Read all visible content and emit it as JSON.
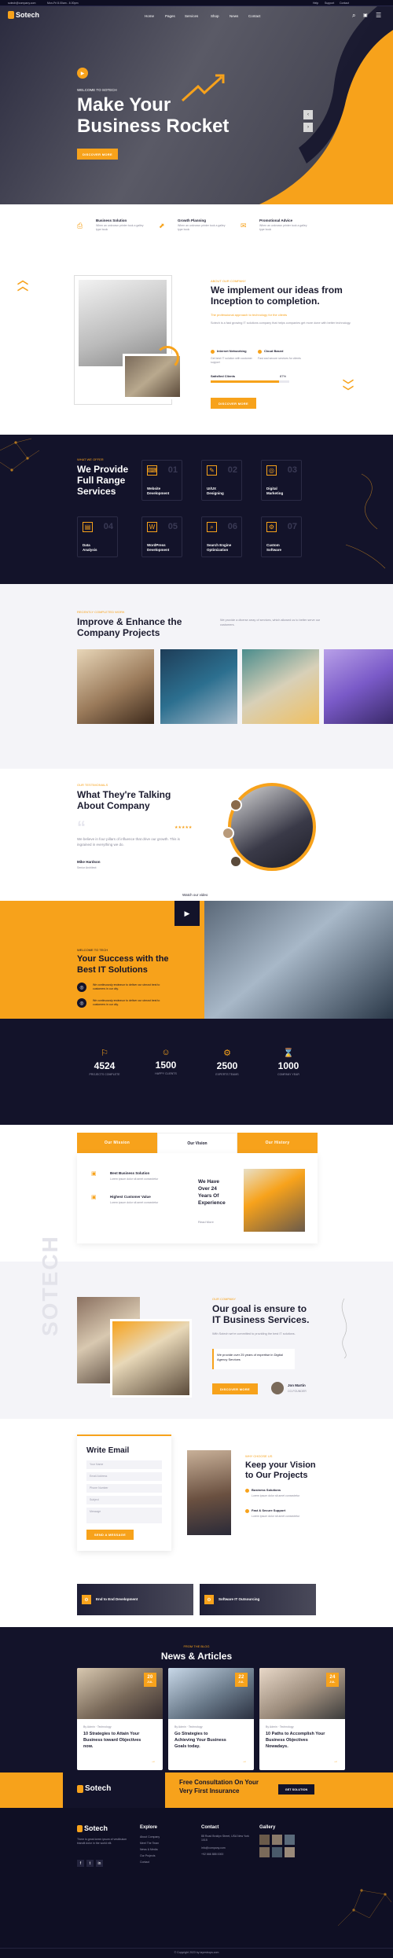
{
  "topbar": {
    "email": "sotech@company.com",
    "hours": "Mon-Fri 8.00am - 6.00pm",
    "links": [
      "Help",
      "Support",
      "Contact"
    ]
  },
  "nav": {
    "brand": "Sotech",
    "items": [
      "Home",
      "Pages",
      "Services",
      "Shop",
      "News",
      "Contact"
    ]
  },
  "hero": {
    "tag": "WELCOME TO SOTECH",
    "title1": "Make Your",
    "title2": "Business Rocket",
    "button": "DISCOVER MORE"
  },
  "features": [
    {
      "title": "Business Solution",
      "text": "When an unknown printer took a galley type book"
    },
    {
      "title": "Growth Planning",
      "text": "When an unknown printer took a galley type book"
    },
    {
      "title": "Promotional Advice",
      "text": "When an unknown printer took a galley type book"
    }
  ],
  "about": {
    "tag": "ABOUT OUR COMPANY",
    "title1": "We implement our ideas from",
    "title2": "Inception to completion.",
    "sub": "The professional approach to technology for the clients",
    "text": "Sotech is a fast growing IT solutions company that helps companies get more done with better technology.",
    "list1": "Internet Networking",
    "list2": "Cloud Based",
    "list3": "Get best IT solution with customer support",
    "list4": "Fast and secure services for clients",
    "bar_label": "Satisfied Clients",
    "bar_value": "87%",
    "bar_fill": 0.87,
    "button": "DISCOVER MORE"
  },
  "services": {
    "tag": "WHAT WE OFFER",
    "title1": "We Provide",
    "title2": "Full Range",
    "title3": "Services",
    "items": [
      {
        "num": "01",
        "label1": "Website",
        "label2": "Development"
      },
      {
        "num": "02",
        "label1": "UI/UX",
        "label2": "Designing"
      },
      {
        "num": "03",
        "label1": "Digital",
        "label2": "Marketing"
      },
      {
        "num": "04",
        "label1": "Data",
        "label2": "Analysis"
      },
      {
        "num": "05",
        "label1": "WordPress",
        "label2": "Development"
      },
      {
        "num": "06",
        "label1": "Search Engine",
        "label2": "Optimization"
      },
      {
        "num": "07",
        "label1": "Custom",
        "label2": "Software"
      }
    ]
  },
  "projects": {
    "tag": "RECENTLY COMPLETED WORK",
    "title1": "Improve & Enhance the",
    "title2": "Company Projects",
    "text": "We provide a diverse array of services, which allowed us to better serve our customers."
  },
  "testimonial": {
    "tag": "OUR TESTIMONIALS",
    "title1": "What They're Talking",
    "title2": "About Company",
    "text": "We believe in four pillars of influence that drive our growth. This is ingrained in everything we do.",
    "name": "Mike Hardson",
    "role": "Senior Architect"
  },
  "video": {
    "label": "Watch our video"
  },
  "success": {
    "tag": "WELCOME TO TECH",
    "title1": "Your Success with the",
    "title2": "Best IT Solutions",
    "item1": "We continuously endeavor to deliver our utmost best to customers in our city.",
    "item2": "We continuously endeavor to deliver our utmost best to customers in our city."
  },
  "counters": [
    {
      "value": "4524",
      "label": "PROJECTS COMPLETE"
    },
    {
      "value": "1500",
      "label": "HAPPY CLIENTS"
    },
    {
      "value": "2500",
      "label": "EXPERTS TEAMS"
    },
    {
      "value": "1000",
      "label": "COMPANY YEAR"
    }
  ],
  "tabs": {
    "items": [
      "Our Mission",
      "Our Vision",
      "Our History"
    ],
    "active": 1,
    "check1": "Best Business Solution",
    "check1_text": "Lorem ipsum dolor sit amet consectetur",
    "check2": "Highest Customer Value",
    "check2_text": "Lorem ipsum dolor sit amet consectetur",
    "exp1": "We Have",
    "exp2": "Over 24",
    "exp3": "Years Of",
    "exp4": "Experience",
    "read": "Read More"
  },
  "goal": {
    "watermark": "SOTECH",
    "tag": "OUR COMPANY",
    "title1": "Our goal is ensure to",
    "title2": "IT Business Services.",
    "text": "With Sotech we're committed to providing the best IT solutions.",
    "quote": "We provide over 25 years of expertise in Digital Agency Services",
    "button": "DISCOVER MORE",
    "sig_name": "Jon Martin",
    "sig_role": "CO-FOUNDER"
  },
  "form": {
    "title": "Write Email",
    "placeholders": [
      "Your Name",
      "Email Address",
      "Phone Number",
      "Subject",
      "Message"
    ],
    "button": "SEND A MESSAGE"
  },
  "vision": {
    "tag": "WHY CHOOSE US",
    "title1": "Keep your Vision",
    "title2": "to Our Projects",
    "item1": "Business Solutions",
    "item1_text": "Lorem ipsum dolor sit amet consectetur",
    "item2": "Fast & Secure Support",
    "item2_text": "Lorem ipsum dolor sit amet consectetur"
  },
  "banners": [
    "End to End Development",
    "Software IT Outsourcing"
  ],
  "news": {
    "tag": "FROM THE BLOG",
    "title": "News & Articles",
    "items": [
      {
        "date": "20",
        "month": "JUL",
        "meta1": "By Admin",
        "meta2": "Technology",
        "title1": "10 Strategies to Attain Your",
        "title2": "Business toward Objectives",
        "title3": "now."
      },
      {
        "date": "22",
        "month": "JUL",
        "meta1": "By Admin",
        "meta2": "Technology",
        "title1": "Go Strategies to",
        "title2": "Achieving Your Business",
        "title3": "Goals today."
      },
      {
        "date": "24",
        "month": "JUL",
        "meta1": "By Admin",
        "meta2": "Technology",
        "title1": "10 Paths to Accomplish Your",
        "title2": "Business Objectives",
        "title3": "Nowadays."
      }
    ]
  },
  "cta": {
    "brand": "Sotech",
    "title1": "Free Consultation On Your",
    "title2": "Very First Insurance",
    "button": "GET SOLUTION"
  },
  "footer": {
    "about": "There is great lorem ipsum of vestibulum blandit dolor in the world elit.",
    "explore_title": "Explore",
    "explore": [
      "About Company",
      "Meet The Team",
      "News & Media",
      "Our Projects",
      "Contact"
    ],
    "contact_title": "Contact",
    "address": "88 Road Broklyn Street, USA New York 1015",
    "email": "info@company.com",
    "phone": "+92 666 888 0000",
    "gallery_title": "Gallery",
    "copyright": "© Copyright 2023 by layerdrops.com"
  },
  "colors": {
    "accent": "#f7a21b",
    "dark": "#13132a"
  }
}
